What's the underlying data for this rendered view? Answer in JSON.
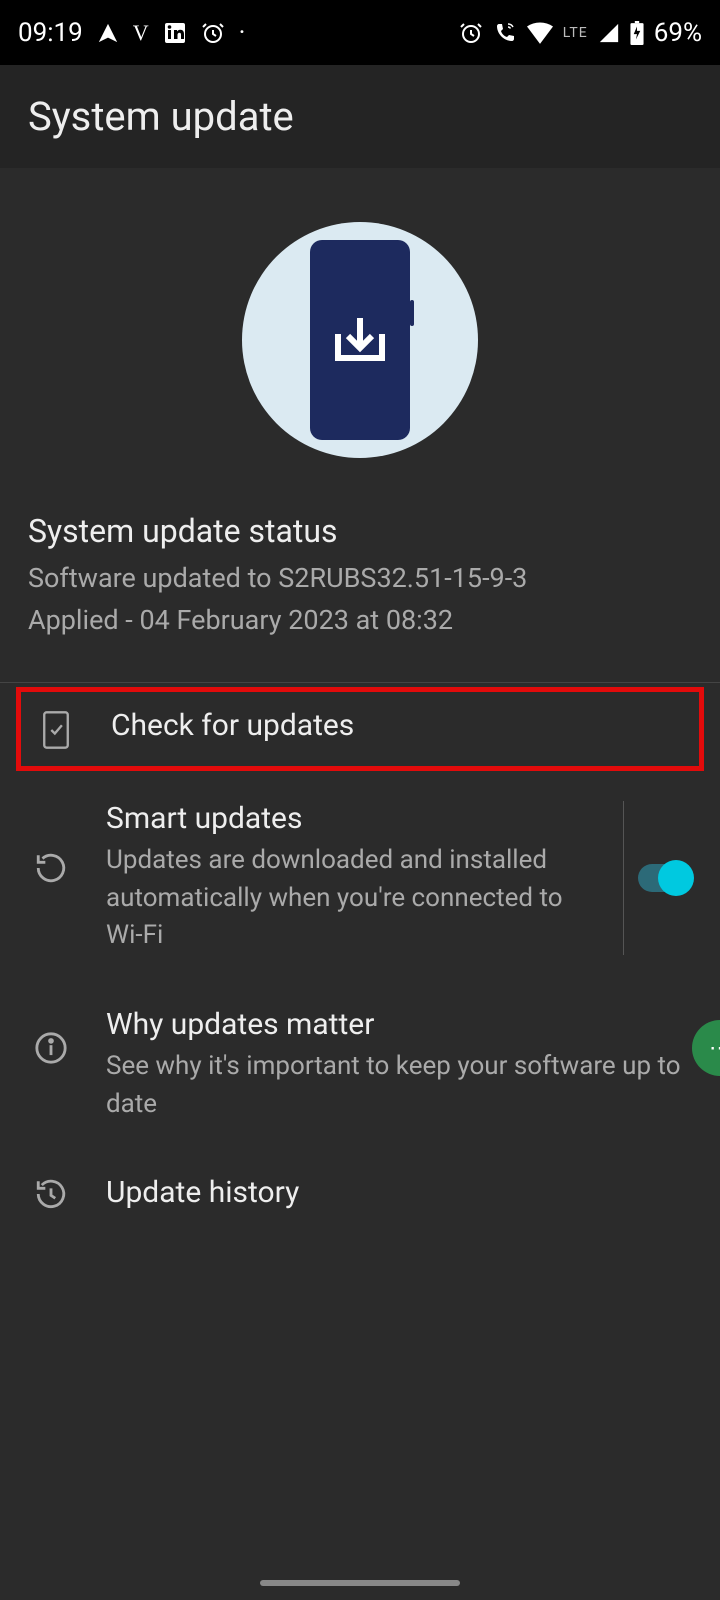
{
  "status_bar": {
    "time": "09:19",
    "lte": "LTE",
    "battery": "69%"
  },
  "header": {
    "title": "System update"
  },
  "status": {
    "heading": "System update status",
    "version": "Software updated to S2RUBS32.51-15-9-3",
    "applied": "Applied - 04 February 2023 at 08:32"
  },
  "items": {
    "check": {
      "title": "Check for updates"
    },
    "smart": {
      "title": "Smart updates",
      "sub": "Updates are downloaded and installed automatically when you're connected to Wi-Fi"
    },
    "why": {
      "title": "Why updates matter",
      "sub": "See why it's important to keep your software up to date"
    },
    "history": {
      "title": "Update history"
    }
  }
}
